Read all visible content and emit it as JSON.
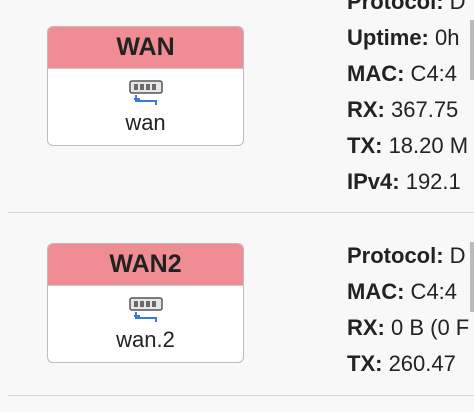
{
  "interfaces": [
    {
      "name": "WAN",
      "device": "wan",
      "icon": "ethernet-port-icon",
      "header_color": "#f08c94",
      "details": [
        {
          "key": "Protocol:",
          "value": " D"
        },
        {
          "key": "Uptime:",
          "value": " 0h"
        },
        {
          "key": "MAC:",
          "value": " C4:4"
        },
        {
          "key": "RX:",
          "value": " 367.75"
        },
        {
          "key": "TX:",
          "value": " 18.20 M"
        },
        {
          "key": "IPv4:",
          "value": " 192.1"
        }
      ]
    },
    {
      "name": "WAN2",
      "device": "wan.2",
      "icon": "ethernet-port-icon",
      "header_color": "#f08c94",
      "details": [
        {
          "key": "Protocol:",
          "value": " D"
        },
        {
          "key": "MAC:",
          "value": " C4:4"
        },
        {
          "key": "RX:",
          "value": " 0 B (0 F"
        },
        {
          "key": "TX:",
          "value": " 260.47"
        }
      ]
    }
  ]
}
